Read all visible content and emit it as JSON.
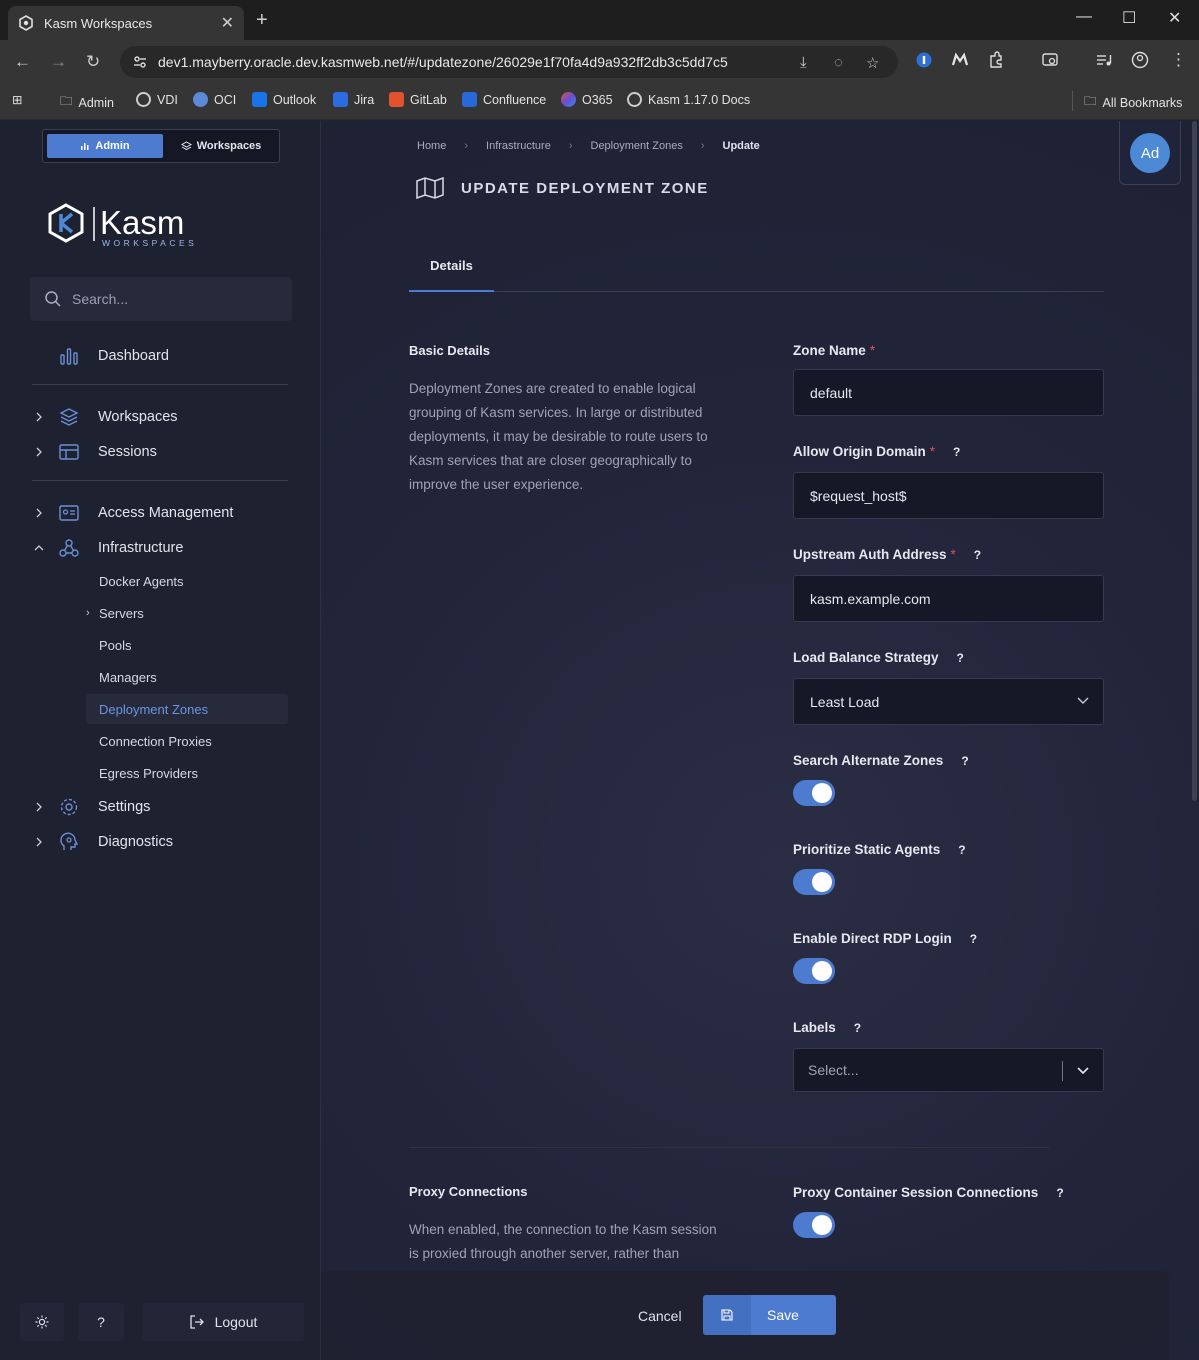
{
  "browser": {
    "tab_title": "Kasm Workspaces",
    "new_tab": "+",
    "url": "dev1.mayberry.oracle.dev.kasmweb.net/#/updatezone/26029e1f70fa4d9a932ff2db3c5dd7c5",
    "bookmarks": [
      "Admin",
      "VDI",
      "OCI",
      "Outlook",
      "Jira",
      "GitLab",
      "Confluence",
      "O365",
      "Kasm 1.17.0 Docs"
    ],
    "all_bookmarks": "All Bookmarks"
  },
  "sidebar": {
    "switch_admin": "Admin",
    "switch_workspaces": "Workspaces",
    "logo_text": "Kasm",
    "logo_sub": "WORKSPACES",
    "search_placeholder": "Search...",
    "dashboard": "Dashboard",
    "workspaces": "Workspaces",
    "sessions": "Sessions",
    "access_management": "Access Management",
    "infrastructure": "Infrastructure",
    "sub": {
      "docker_agents": "Docker Agents",
      "servers": "Servers",
      "pools": "Pools",
      "managers": "Managers",
      "deployment_zones": "Deployment Zones",
      "connection_proxies": "Connection Proxies",
      "egress_providers": "Egress Providers"
    },
    "settings": "Settings",
    "diagnostics": "Diagnostics",
    "help": "?",
    "logout": "Logout"
  },
  "breadcrumb": [
    "Home",
    "Infrastructure",
    "Deployment Zones",
    "Update"
  ],
  "page_title": "UPDATE DEPLOYMENT ZONE",
  "avatar": "Ad",
  "tabs": {
    "details": "Details"
  },
  "basic": {
    "title": "Basic Details",
    "desc": "Deployment Zones are created to enable logical grouping of Kasm services. In large or distributed deployments, it may be desirable to route users to Kasm services that are closer geographically to improve the user experience."
  },
  "fields": {
    "zone_name_label": "Zone Name",
    "zone_name": "default",
    "origin_label": "Allow Origin Domain",
    "origin": "$request_host$",
    "upstream_label": "Upstream Auth Address",
    "upstream": "kasm.example.com",
    "lb_label": "Load Balance Strategy",
    "lb_value": "Least Load",
    "search_alt_label": "Search Alternate Zones",
    "search_alt_on": true,
    "prioritize_label": "Prioritize Static Agents",
    "prioritize_on": true,
    "rdp_label": "Enable Direct RDP Login",
    "rdp_on": true,
    "labels_label": "Labels",
    "labels_placeholder": "Select...",
    "required_mark": "*",
    "help_mark": "?"
  },
  "proxy": {
    "title": "Proxy Connections",
    "desc": "When enabled, the connection to the Kasm session is proxied through another server, rather than",
    "toggle_label": "Proxy Container Session Connections",
    "toggle_on": true
  },
  "footer": {
    "cancel": "Cancel",
    "save": "Save"
  },
  "colors": {
    "accent": "#4d7bcf",
    "active_link": "#6b95e3",
    "required": "#d9534f"
  }
}
